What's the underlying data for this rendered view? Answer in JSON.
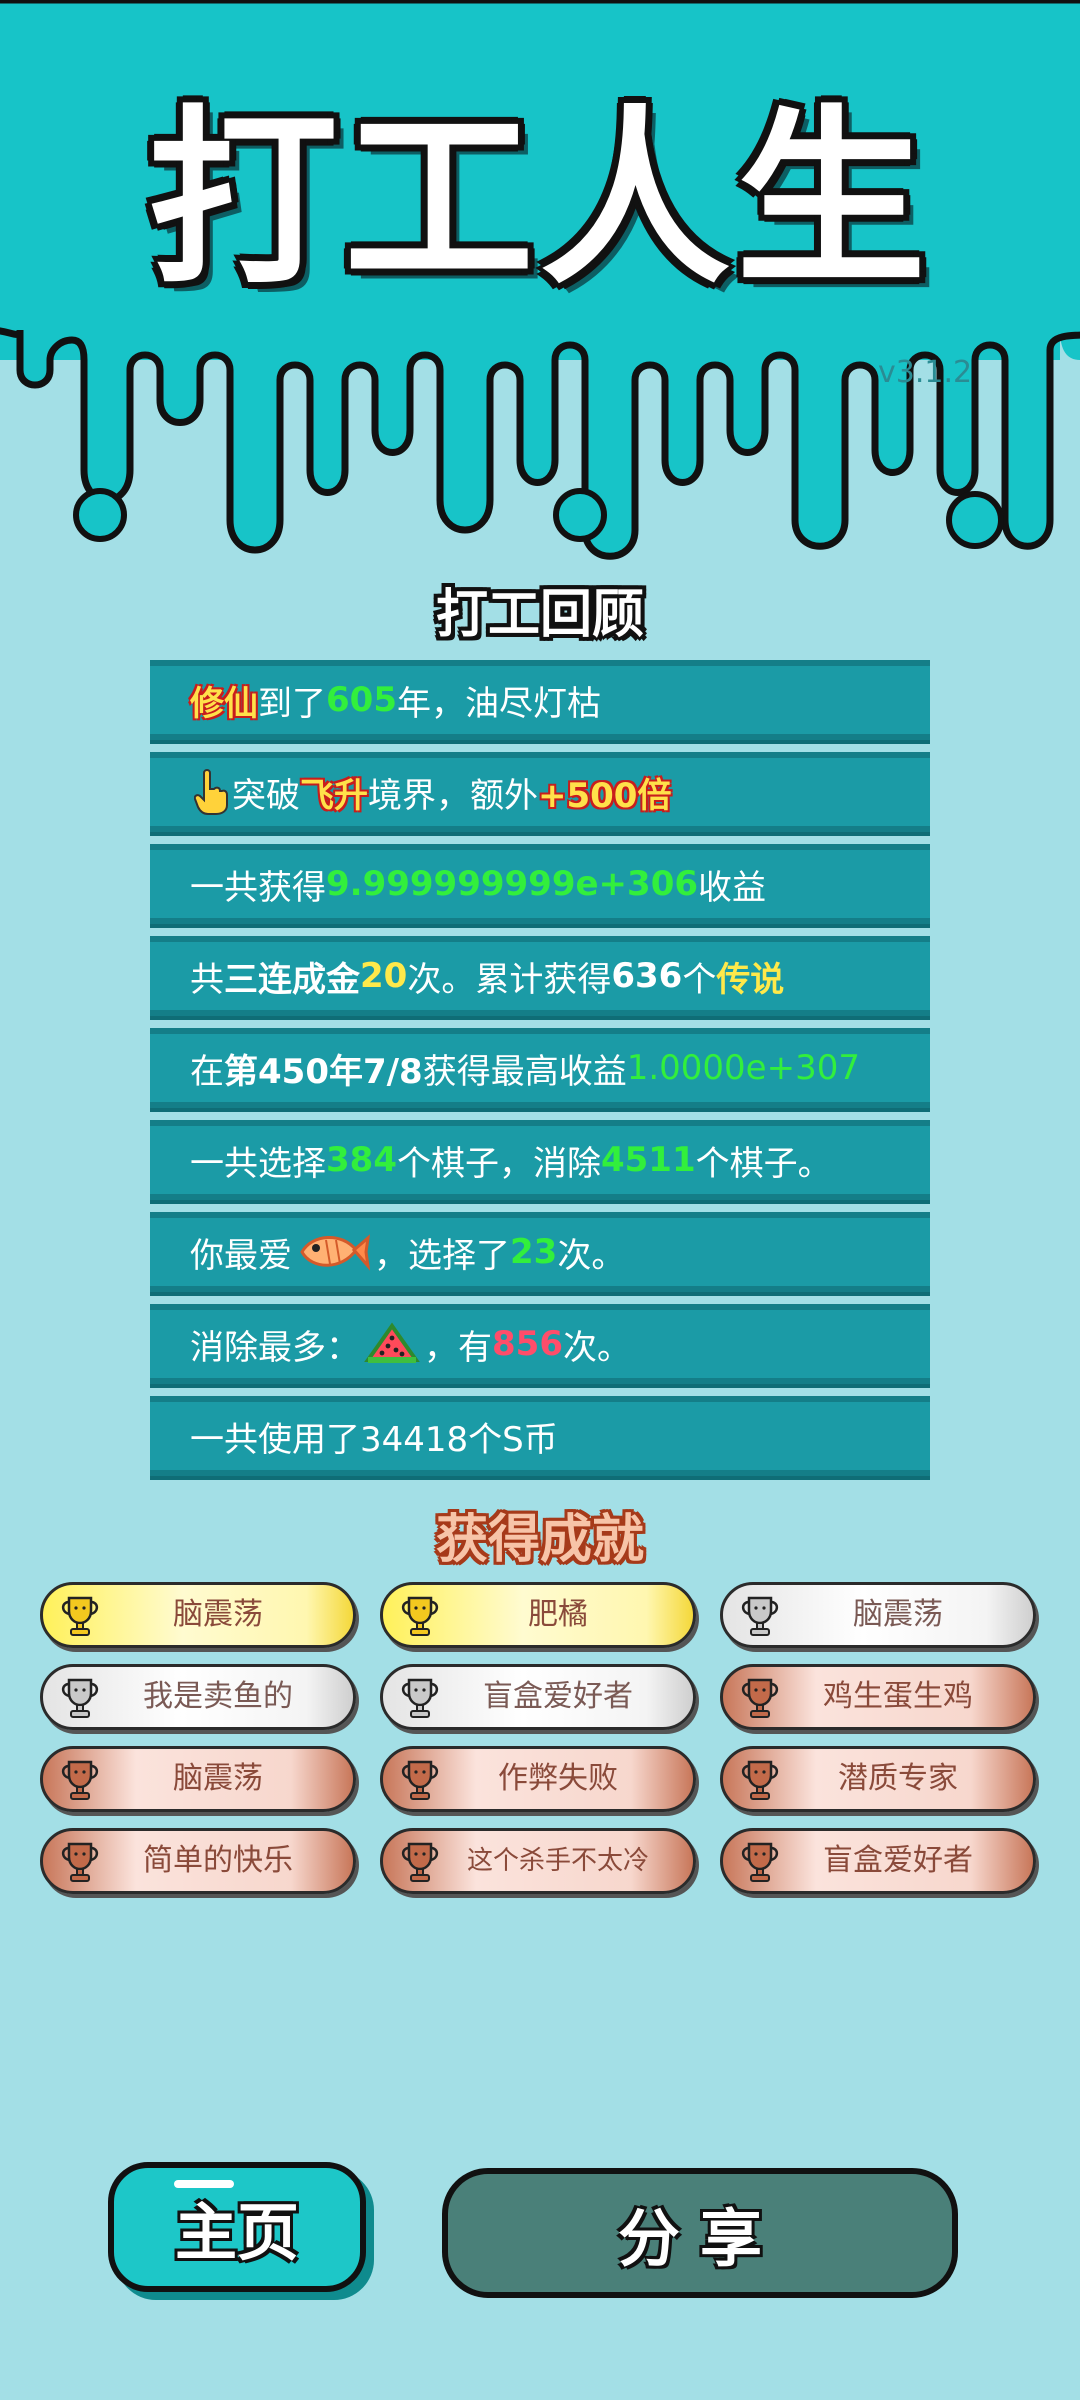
{
  "header": {
    "app_title": "打工人生",
    "version": "v3.1.2"
  },
  "review": {
    "heading": "打工回顾",
    "rows": [
      {
        "parts": [
          "修仙",
          "到了",
          "605",
          "年，油尽灯枯"
        ]
      },
      {
        "parts": [
          "突破",
          "飞升",
          "境界，额外",
          "+500倍"
        ]
      },
      {
        "parts": [
          "一共获得",
          "9.999999999e+306",
          "收益"
        ]
      },
      {
        "parts": [
          "共",
          "三连成金",
          "20",
          "次。累计获得",
          "636",
          "个",
          "传说"
        ]
      },
      {
        "parts": [
          "在 ",
          "第450年7/8",
          " 获得最高收益",
          "1.0000e+307"
        ]
      },
      {
        "parts": [
          "一共选择",
          "384",
          "个棋子，消除",
          "4511",
          "个棋子。"
        ]
      },
      {
        "parts": [
          "你最爱",
          "，选择了",
          "23",
          "次。"
        ]
      },
      {
        "parts": [
          "消除最多：",
          "，有",
          "856",
          "次。"
        ]
      },
      {
        "parts": [
          "一共使用了34418个S币"
        ]
      }
    ],
    "icons": {
      "row2": "hand-pointer-icon",
      "row7": "fish-icon",
      "row8": "watermelon-icon"
    }
  },
  "achievements": {
    "heading": "获得成就",
    "items": [
      {
        "label": "脑震荡",
        "tier": "gold"
      },
      {
        "label": "肥橘",
        "tier": "gold"
      },
      {
        "label": "脑震荡",
        "tier": "silver"
      },
      {
        "label": "我是卖鱼的",
        "tier": "silver"
      },
      {
        "label": "盲盒爱好者",
        "tier": "silver"
      },
      {
        "label": "鸡生蛋生鸡",
        "tier": "bronze"
      },
      {
        "label": "脑震荡",
        "tier": "bronze"
      },
      {
        "label": "作弊失败",
        "tier": "bronze"
      },
      {
        "label": "潜质专家",
        "tier": "bronze"
      },
      {
        "label": "简单的快乐",
        "tier": "bronze"
      },
      {
        "label": "这个杀手不太冷",
        "tier": "bronze"
      },
      {
        "label": "盲盒爱好者",
        "tier": "bronze"
      }
    ]
  },
  "buttons": {
    "home": "主页",
    "share": "分享"
  },
  "colors": {
    "top_band": "#17c4c8",
    "background": "#a3dfe6",
    "row_bg": "#1b9ba6",
    "highlight_green": "#32ef3c",
    "highlight_yellow": "#ffe94a",
    "highlight_pink": "#ff4d6a",
    "share_button": "#4a8079"
  }
}
